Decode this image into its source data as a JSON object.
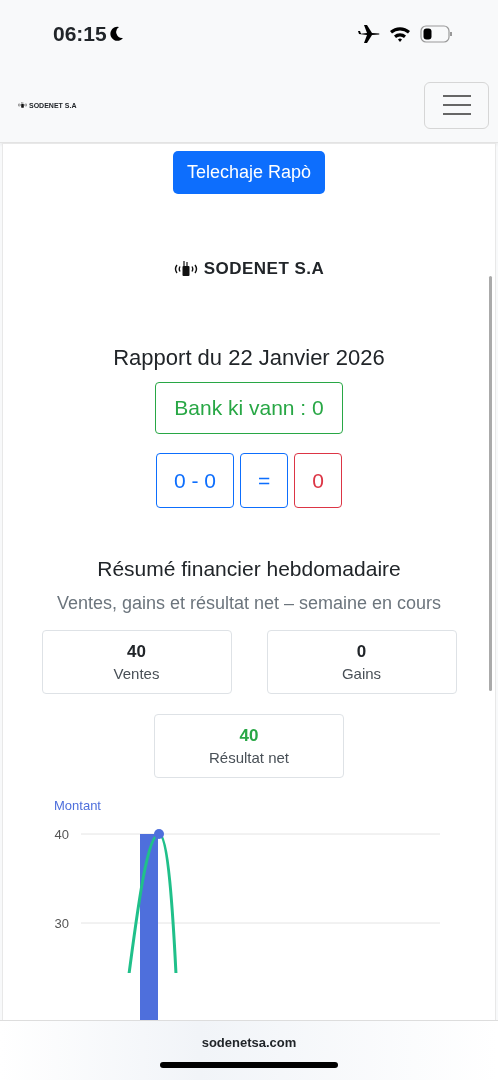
{
  "status_bar": {
    "time": "06:15"
  },
  "header": {
    "brand": "SODENET S.A"
  },
  "report": {
    "download_button": "Telechaje Rapò",
    "brand": "SODENET S.A",
    "title": "Rapport du 22 Janvier 2026",
    "bank": "Bank ki vann : 0",
    "equation": [
      {
        "text": "0 - 0",
        "color": "#0d6efd"
      },
      {
        "text": "=",
        "color": "#0d6efd"
      },
      {
        "text": "0",
        "color": "#dc3545"
      }
    ]
  },
  "summary": {
    "title": "Résumé financier hebdomadaire",
    "subtitle": "Ventes, gains et résultat net – semaine en cours",
    "stats": [
      {
        "value": "40",
        "label": "Ventes",
        "color": "#212529"
      },
      {
        "value": "0",
        "label": "Gains",
        "color": "#212529"
      },
      {
        "value": "40",
        "label": "Résultat net",
        "color": "#28a745"
      }
    ],
    "chart_data": {
      "type": "bar",
      "ylabel": "Montant",
      "ylim": [
        0,
        40
      ],
      "yticks": [
        30,
        40
      ],
      "series": [
        {
          "color": "#4e6fdc",
          "values": [
            40
          ]
        }
      ]
    }
  },
  "browser_bar": {
    "url": "sodenetsa.com"
  }
}
